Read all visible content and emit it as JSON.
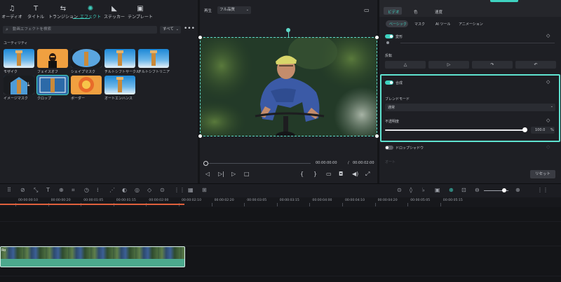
{
  "left_tabs": [
    {
      "label": "オーディオ",
      "icon": "music-note-icon",
      "glyph": "♫",
      "active": false
    },
    {
      "label": "タイトル",
      "icon": "text-t-icon",
      "glyph": "T",
      "active": false
    },
    {
      "label": "トランジション",
      "icon": "transition-icon",
      "glyph": "⇆",
      "active": false
    },
    {
      "label": "エフェクト",
      "icon": "effects-sparkle-icon",
      "glyph": "✺",
      "active": true
    },
    {
      "label": "ステッカー",
      "icon": "sticker-icon",
      "glyph": "◣",
      "active": false
    },
    {
      "label": "テンプレート",
      "icon": "template-icon",
      "glyph": "▣",
      "active": false
    }
  ],
  "search": {
    "placeholder": "動画エフェクトを検索",
    "icon": "search-icon"
  },
  "filter": {
    "label": "すべて",
    "icon": "chevron-down-icon"
  },
  "more": "•••",
  "section_header": "ユーティリティ",
  "effects": [
    {
      "label": "モザイク"
    },
    {
      "label": "フェイスオフ"
    },
    {
      "label": "シェイプマスク"
    },
    {
      "label": "チルトシフトサークル"
    },
    {
      "label": "チルトシフトリニア"
    },
    {
      "label": "イメージマスク"
    },
    {
      "label": "クロップ"
    },
    {
      "label": "ボーダー"
    },
    {
      "label": "オートエンハンス"
    }
  ],
  "preview": {
    "playback_label": "再生",
    "quality_label": "フル品質",
    "time_current": "00:00:00:00",
    "time_sep": "/",
    "time_total": "00:00:02:00"
  },
  "right": {
    "tabs": [
      "ビデオ",
      "色",
      "速度"
    ],
    "subtabs": [
      "ベーシック",
      "マスク",
      "AI ツール",
      "アニメーション"
    ],
    "transform_label": "変形",
    "flip_label": "反転",
    "composite_label": "合成",
    "blend_label": "ブレンドモード",
    "blend_value": "通常",
    "opacity_label": "不透明度",
    "opacity_value": "100.0",
    "opacity_unit": "%",
    "opacity_fraction": 1.0,
    "dropshadow_label": "ドロップシャドウ",
    "faded_label": "オート",
    "reset_label": "リセット"
  },
  "ruler_ticks": [
    "00:00:00:10",
    "00:00:00:20",
    "00:00:01:05",
    "00:00:01:15",
    "00:00:02:00",
    "00:00:02:10",
    "00:00:02:20",
    "00:00:03:05",
    "00:00:03:15",
    "00:00:04:00",
    "00:00:04:10",
    "00:00:04:20",
    "00:00:05:05",
    "00:00:05:15"
  ],
  "clip_label": "Ro",
  "colors": {
    "accent": "#3fd2c0",
    "playhead": "#e0603c",
    "clip": "#4ca98d"
  }
}
